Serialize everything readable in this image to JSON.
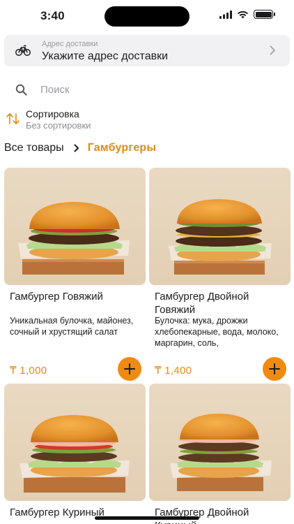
{
  "status_bar": {
    "time": "3:40",
    "battery_level": 1.0
  },
  "address": {
    "label": "Адрес доставки",
    "value": "Укажите адрес доставки",
    "icon": "bicycle-icon"
  },
  "search": {
    "placeholder": "Поиск",
    "icon": "search-icon"
  },
  "sort": {
    "title": "Сортировка",
    "value": "Без сортировки",
    "icon": "sort-arrows-icon"
  },
  "breadcrumb": {
    "root": "Все товары",
    "current": "Гамбургеры"
  },
  "colors": {
    "accent": "#E28A16",
    "add_button": "#EF8A12",
    "photo_bg": "#E7D6BE"
  },
  "products": [
    {
      "title": "Гамбургер Говяжий",
      "description": "Уникальная булочка, майонез, сочный и хрустящий салат",
      "price": "₸ 1,000",
      "add_icon": "plus-icon"
    },
    {
      "title": "Гамбургер Двойной Говяжий",
      "description": "Булочка: мука, дрожжи хлебопекарные, вода, молоко, маргарин, соль,",
      "price": "₸ 1,400",
      "add_icon": "plus-icon"
    },
    {
      "title": "Гамбургер Куриный",
      "description": "",
      "price": "",
      "add_icon": "plus-icon"
    },
    {
      "title": "Гамбургер Двойной Куриный",
      "description": "",
      "price": "",
      "add_icon": "plus-icon"
    }
  ]
}
